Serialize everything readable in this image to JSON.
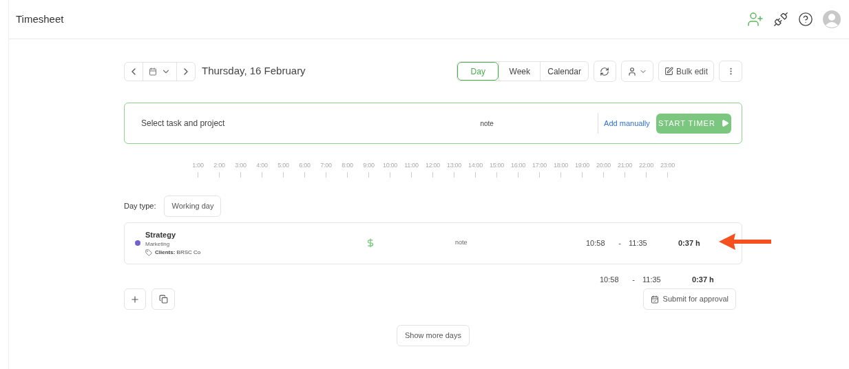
{
  "header": {
    "title": "Timesheet"
  },
  "date_nav": {
    "date": "Thursday, 16 February"
  },
  "views": [
    {
      "label": "Day",
      "selected": true
    },
    {
      "label": "Week",
      "selected": false
    },
    {
      "label": "Calendar",
      "selected": false
    }
  ],
  "toolbar": {
    "bulk_edit": "Bulk edit"
  },
  "timer": {
    "placeholder": "Select task and project",
    "note_placeholder": "note",
    "add_manually": "Add manually",
    "start": "START TIMER"
  },
  "timeline": [
    "1:00",
    "2:00",
    "3:00",
    "4:00",
    "5:00",
    "6:00",
    "7:00",
    "8:00",
    "9:00",
    "10:00",
    "11:00",
    "12:00",
    "13:00",
    "14:00",
    "15:00",
    "16:00",
    "17:00",
    "18:00",
    "19:00",
    "20:00",
    "21:00",
    "22:00",
    "23:00"
  ],
  "day_type": {
    "label": "Day type:",
    "value": "Working day"
  },
  "entries": [
    {
      "task": "Strategy",
      "project": "Marketing",
      "color": "#7461cf",
      "tag_label": "Clients:",
      "tag": "BRSC Co",
      "billable": true,
      "note": "note",
      "start": "10:58",
      "dash": "-",
      "end": "11:35",
      "duration": "0:37 h"
    }
  ],
  "totals": {
    "start": "10:58",
    "dash": "-",
    "end": "11:35",
    "duration": "0:37 h"
  },
  "submit": "Submit for approval",
  "show_more": "Show more days"
}
